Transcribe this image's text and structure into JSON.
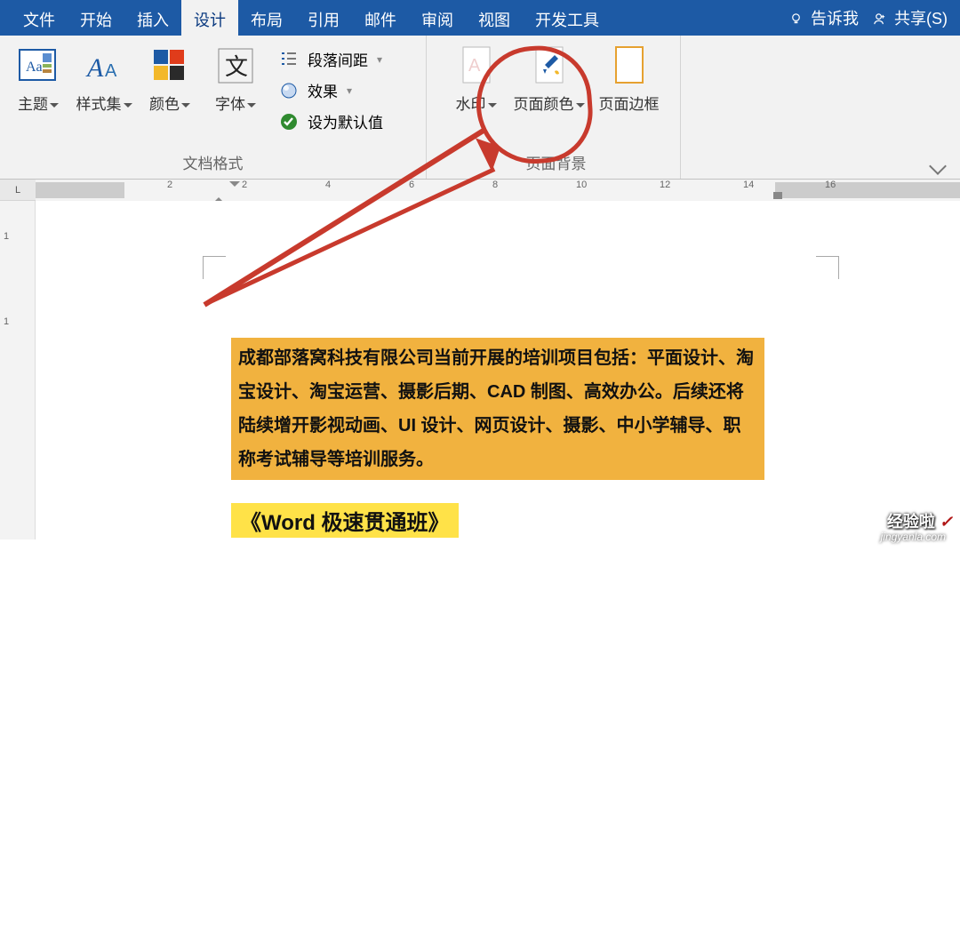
{
  "tabs": {
    "file": "文件",
    "home": "开始",
    "insert": "插入",
    "design": "设计",
    "layout": "布局",
    "references": "引用",
    "mail": "邮件",
    "review": "审阅",
    "view": "视图",
    "devtools": "开发工具",
    "tellme": "告诉我",
    "share": "共享(S)"
  },
  "ribbon": {
    "docfmt": {
      "themes": "主题",
      "styleset": "样式集",
      "colors": "颜色",
      "fonts": "字体",
      "group_label": "文档格式",
      "opts": {
        "para_spacing": "段落间距",
        "effects": "效果",
        "set_default": "设为默认值"
      }
    },
    "pagebg": {
      "watermark": "水印",
      "pagecolor": "页面颜色",
      "pageborder": "页面边框",
      "group_label": "页面背景"
    }
  },
  "ruler": {
    "label": "L",
    "ticks": [
      "2",
      "2",
      "4",
      "6",
      "8",
      "10",
      "12",
      "14",
      "16"
    ]
  },
  "vruler": {
    "ticks": [
      "1",
      "1"
    ]
  },
  "document": {
    "para1": "成都部落窝科技有限公司当前开展的培训项目包括：平面设计、淘宝设计、淘宝运营、摄影后期、CAD 制图、高效办公。后续还将陆续增开影视动画、UI 设计、网页设计、摄影、中小学辅导、职称考试辅导等培训服务。",
    "para2": "《Word 极速贯通班》"
  },
  "watermark": {
    "brand_zh": "经验啦",
    "check": "✓",
    "url": "jingyanla.com"
  }
}
